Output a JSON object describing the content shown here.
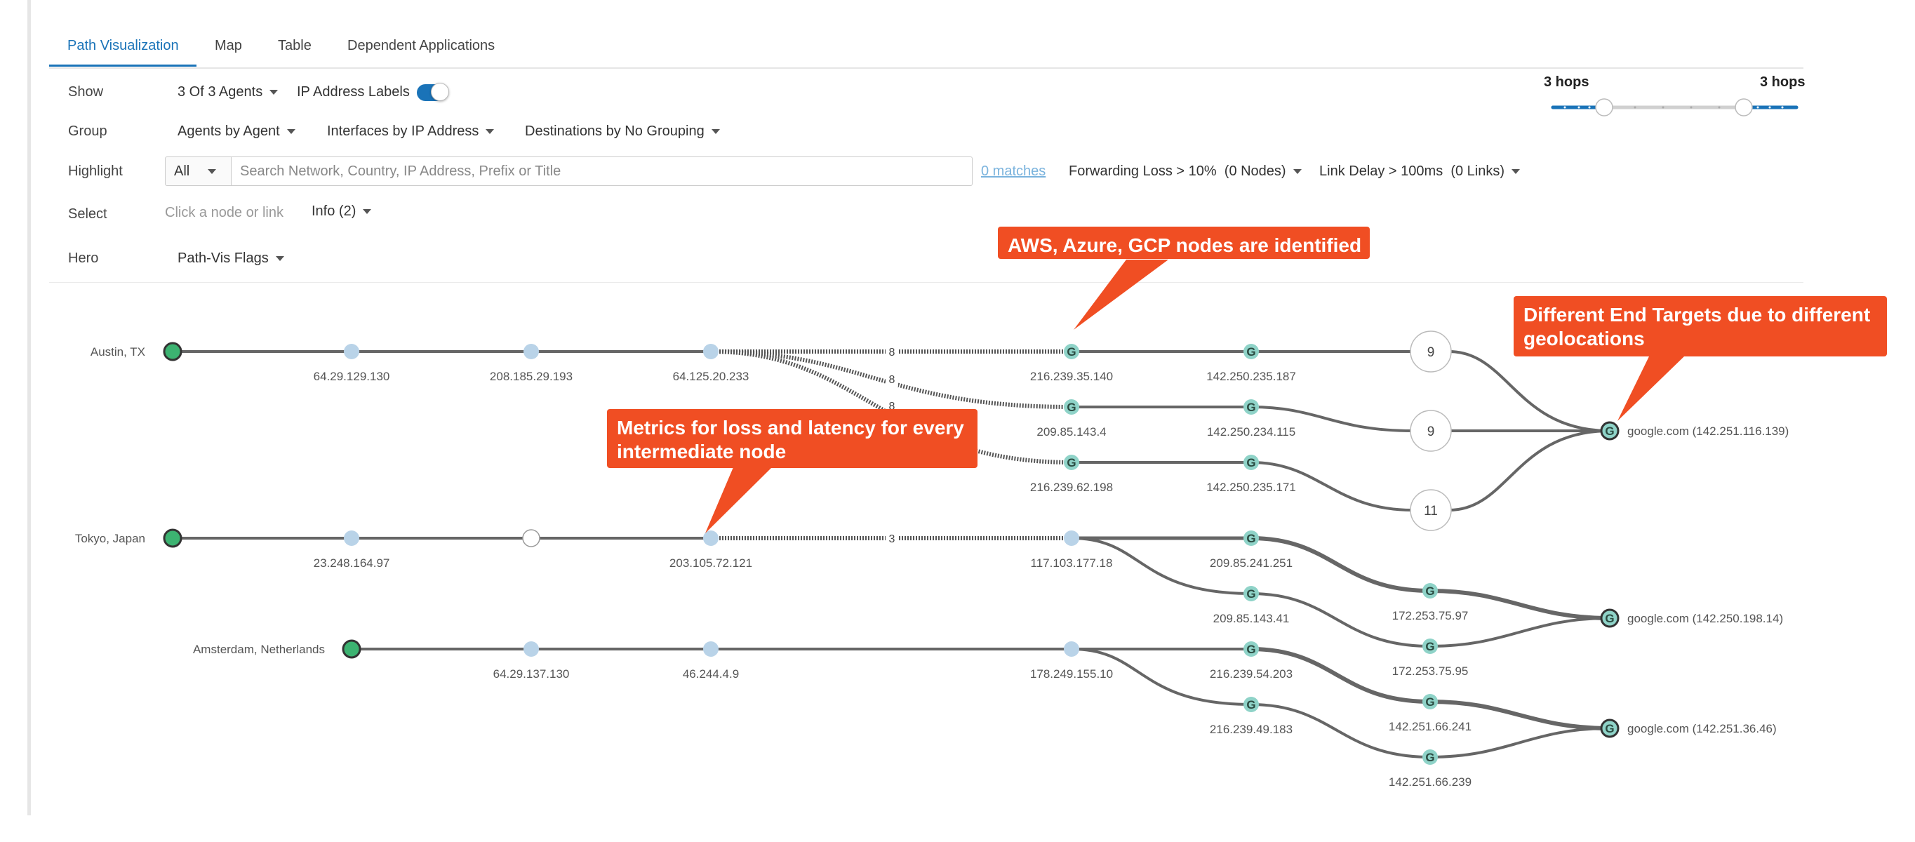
{
  "tabs": [
    "Path Visualization",
    "Map",
    "Table",
    "Dependent Applications"
  ],
  "controls": {
    "show_label": "Show",
    "show_agents": "3 Of 3 Agents",
    "ip_labels": "IP Address Labels",
    "group_label": "Group",
    "group_agents": "Agents by Agent",
    "group_interfaces": "Interfaces by IP Address",
    "group_destinations": "Destinations by No Grouping",
    "highlight_label": "Highlight",
    "highlight_mode": "All",
    "search_placeholder": "Search Network, Country, IP Address, Prefix or Title",
    "matches": "0 matches",
    "forwarding_loss": "Forwarding Loss > 10%  (0 Nodes)",
    "link_delay": "Link Delay > 100ms  (0 Links)",
    "select_label": "Select",
    "select_hint": "Click a node or link",
    "info": "Info (2)",
    "hero_label": "Hero",
    "hero_value": "Path-Vis Flags"
  },
  "hops": {
    "min": "3 hops",
    "max": "3 hops"
  },
  "colors": {
    "accent": "#1a73b8",
    "agent": "#3cb371",
    "callout": "#f04e23",
    "node": "#b9d3e8",
    "cloud": "#8fd3c8"
  },
  "callouts": {
    "cloud": "AWS, Azure, GCP nodes are identified",
    "end_targets": "Different End Targets due to different geolocations",
    "metrics": "Metrics for loss and latency for every intermediate node"
  },
  "agents": [
    "Austin, TX",
    "Tokyo, Japan",
    "Amsterdam, Netherlands"
  ],
  "nodes": {
    "n1": "64.29.129.130",
    "n2": "208.185.29.193",
    "n3": "64.125.20.233",
    "c1": "216.239.35.140",
    "c2": "142.250.235.187",
    "c3": "209.85.143.4",
    "c4": "142.250.234.115",
    "c5": "216.239.62.198",
    "c6": "142.250.235.171",
    "t1": "23.248.164.97",
    "t3": "203.105.72.121",
    "t4": "117.103.177.18",
    "t5": "209.85.241.251",
    "t6": "209.85.143.41",
    "t7": "172.253.75.97",
    "t8": "172.253.75.95",
    "a1": "64.29.137.130",
    "a2": "46.244.4.9",
    "a3": "178.249.155.10",
    "a4": "216.239.54.203",
    "a5": "216.239.49.183",
    "a6": "142.251.66.241",
    "a7": "142.251.66.239"
  },
  "hidden_hops": {
    "h1": "9",
    "h2": "9",
    "h3": "11"
  },
  "link_counts": {
    "l1": "8",
    "l2": "8",
    "l3": "8",
    "l4": "3"
  },
  "destinations": [
    "google.com (142.251.116.139)",
    "google.com (142.250.198.14)",
    "google.com (142.251.36.46)"
  ],
  "icons": {
    "cloud_node": "google-g-icon",
    "dropdown": "caret-down-icon"
  }
}
